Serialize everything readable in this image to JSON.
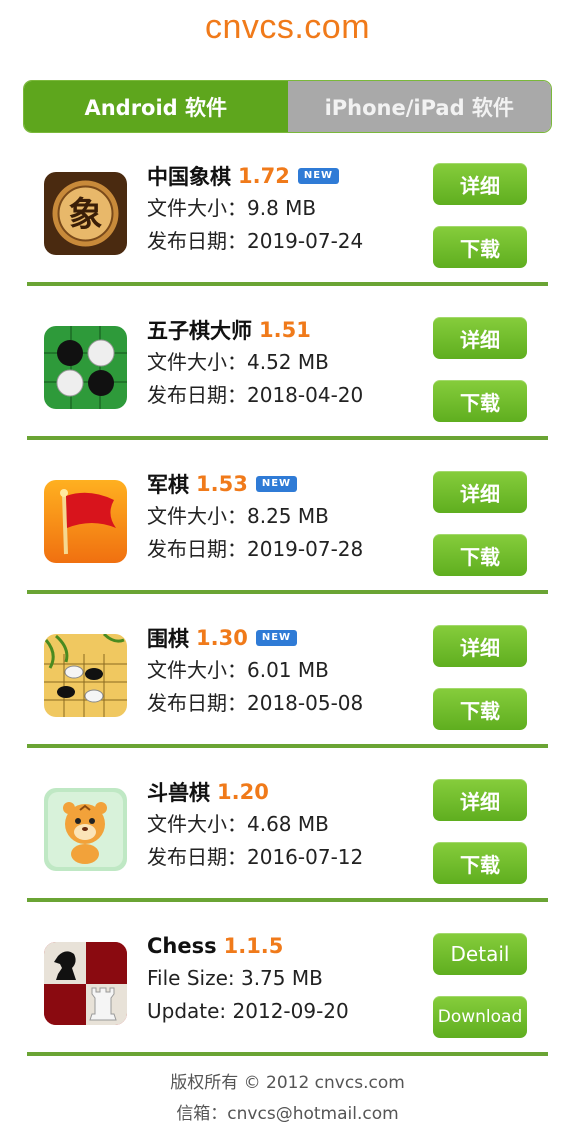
{
  "site": {
    "title": "cnvcs.com"
  },
  "tabs": [
    {
      "label": "Android 软件",
      "active": true
    },
    {
      "label": "iPhone/iPad 软件",
      "active": false
    }
  ],
  "apps": [
    {
      "name": "中国象棋",
      "version": "1.72",
      "badge": "NEW",
      "size": "文件大小：9.8 MB",
      "date": "发布日期：2019-07-24",
      "detail": "详细",
      "download": "下载",
      "icon": "xiangqi-icon",
      "icon_char": "象"
    },
    {
      "name": "五子棋大师",
      "version": "1.51",
      "badge": "",
      "size": "文件大小：4.52 MB",
      "date": "发布日期：2018-04-20",
      "detail": "详细",
      "download": "下载",
      "icon": "gomoku-icon"
    },
    {
      "name": "军棋",
      "version": "1.53",
      "badge": "NEW",
      "size": "文件大小：8.25 MB",
      "date": "发布日期：2019-07-28",
      "detail": "详细",
      "download": "下载",
      "icon": "red-flag-icon"
    },
    {
      "name": "围棋",
      "version": "1.30",
      "badge": "NEW",
      "size": "文件大小：6.01 MB",
      "date": "发布日期：2018-05-08",
      "detail": "详细",
      "download": "下载",
      "icon": "go-board-icon"
    },
    {
      "name": "斗兽棋",
      "version": "1.20",
      "badge": "",
      "size": "文件大小：4.68 MB",
      "date": "发布日期：2016-07-12",
      "detail": "详细",
      "download": "下载",
      "icon": "tiger-icon"
    },
    {
      "name": "Chess",
      "version": "1.1.5",
      "badge": "",
      "size": "File Size: 3.75 MB",
      "date": "Update: 2012-09-20",
      "detail": "Detail",
      "download": "Download",
      "icon": "chess-icon"
    }
  ],
  "footer": {
    "copyright": "版权所有 © 2012 cnvcs.com",
    "email": "信箱：cnvcs@hotmail.com"
  },
  "colors": {
    "accent_green": "#5ea61d",
    "version_orange": "#f07a1a",
    "badge_blue": "#2f7bd6",
    "separator": "#6aa434"
  }
}
